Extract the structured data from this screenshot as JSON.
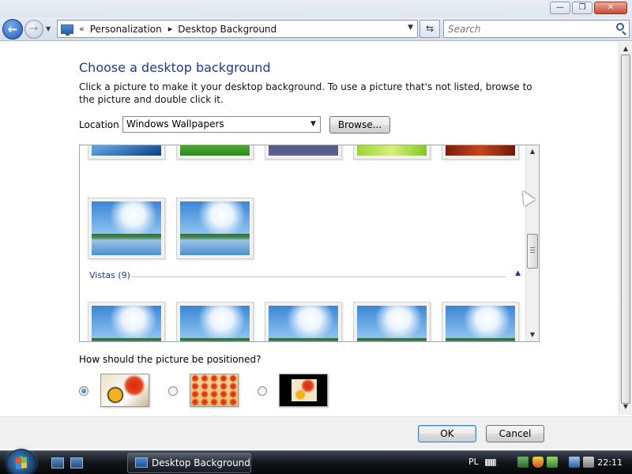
{
  "window": {
    "controls": {
      "minimize": "—",
      "maximize": "❐",
      "close": "✕"
    }
  },
  "nav": {
    "back_icon": "back-arrow-icon",
    "forward_icon": "forward-arrow-icon",
    "breadcrumb_prefix": "«",
    "breadcrumb": [
      "Personalization",
      "Desktop Background"
    ],
    "breadcrumb_sep": "▸",
    "refresh_icon": "refresh-icon",
    "search_placeholder": "Search"
  },
  "main": {
    "title": "Choose a desktop background",
    "instructions": "Click a picture to make it your desktop background. To use a picture that's not listed, browse to the picture and double click it.",
    "location_label": "Location",
    "location_value": "Windows Wallpapers",
    "browse_label": "Browse...",
    "gallery": {
      "top_row": [
        "blue",
        "green",
        "stones",
        "lime",
        "wood"
      ],
      "middle_row": [
        "vista",
        "vista"
      ],
      "group_label": "Vistas (9)",
      "bottom_row": [
        "vista",
        "vista",
        "vista",
        "vista",
        "vista"
      ]
    },
    "position_label": "How should the picture be positioned?",
    "position_options": [
      {
        "name": "fit",
        "checked": true
      },
      {
        "name": "tile",
        "checked": false
      },
      {
        "name": "center",
        "checked": false
      }
    ]
  },
  "footer": {
    "ok_label": "OK",
    "cancel_label": "Cancel"
  },
  "taskbar": {
    "task_label": "Desktop Background",
    "language": "PL",
    "clock": "22:11"
  },
  "colors": {
    "title": "#1e3a8a",
    "taskbar": "#12161b"
  }
}
